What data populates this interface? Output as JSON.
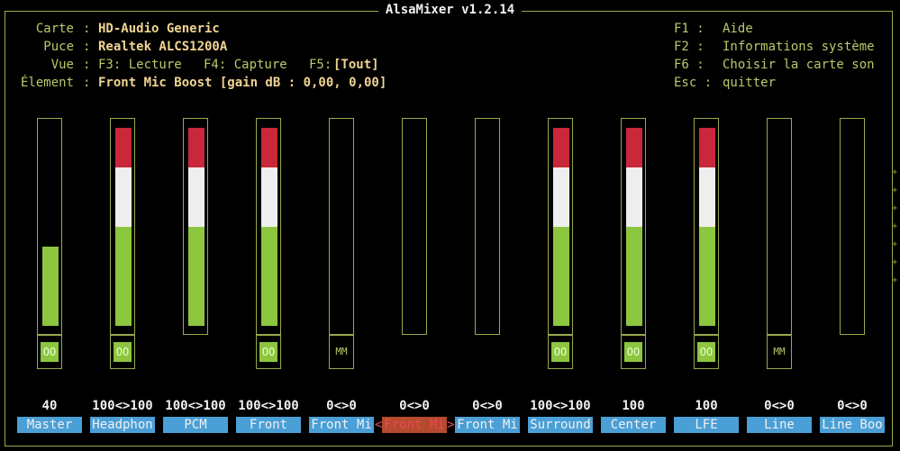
{
  "title": "AlsaMixer v1.2.14",
  "info": {
    "card_label": "Carte",
    "card_value": "HD-Audio Generic",
    "chip_label": "Puce",
    "chip_value": "Realtek ALCS1200A",
    "view_label": "Vue",
    "view_f3": "F3: Lecture",
    "view_f4": "F4: Capture",
    "view_f5": "F5:",
    "view_f5_value": "[Tout]",
    "element_label": "Élement",
    "element_value": "Front Mic Boost [gain dB : 0,00, 0,00]"
  },
  "keys": [
    {
      "key": "F1 :",
      "label": "Aide"
    },
    {
      "key": "F2 :",
      "label": "Informations système"
    },
    {
      "key": "F6 :",
      "label": "Choisir la carte son"
    },
    {
      "key": "Esc :",
      "label": "quitter"
    }
  ],
  "channels": [
    {
      "name": "Master",
      "value": "40",
      "level": 0.4,
      "switch": "OO",
      "type": "mono"
    },
    {
      "name": "Headphon",
      "value": "100<>100",
      "level": 1.0,
      "switch": "OO",
      "type": "full"
    },
    {
      "name": "PCM",
      "value": "100<>100",
      "level": 1.0,
      "switch": "",
      "type": "full"
    },
    {
      "name": "Front",
      "value": "100<>100",
      "level": 1.0,
      "switch": "OO",
      "type": "full"
    },
    {
      "name": "Front Mi",
      "value": "0<>0",
      "level": 0.0,
      "switch": "MM",
      "type": "empty"
    },
    {
      "name": "Front Mi",
      "value": "0<>0",
      "level": 0.0,
      "switch": "",
      "type": "empty",
      "selected": true
    },
    {
      "name": "Front Mi",
      "value": "0<>0",
      "level": 0.0,
      "switch": "",
      "type": "empty"
    },
    {
      "name": "Surround",
      "value": "100<>100",
      "level": 1.0,
      "switch": "OO",
      "type": "full"
    },
    {
      "name": "Center",
      "value": "100",
      "level": 1.0,
      "switch": "OO",
      "type": "full"
    },
    {
      "name": "LFE",
      "value": "100",
      "level": 1.0,
      "switch": "OO",
      "type": "full"
    },
    {
      "name": "Line",
      "value": "0<>0",
      "level": 0.0,
      "switch": "MM",
      "type": "empty"
    },
    {
      "name": "Line Boo",
      "value": "0<>0",
      "level": 0.0,
      "switch": "",
      "type": "empty"
    }
  ],
  "selection_arrows": {
    "left": "<",
    "right": ">"
  },
  "colors": {
    "background": "#000000",
    "frame": "#9aa84a",
    "label": "#b9c96a",
    "value": "#f0d493",
    "bar_red": "#c8283a",
    "bar_white": "#eeeeee",
    "bar_green": "#8cc63e",
    "name_bg": "#4a9fd6",
    "name_selected_bg": "#b54a2e",
    "selected_text": "#e84a55"
  }
}
